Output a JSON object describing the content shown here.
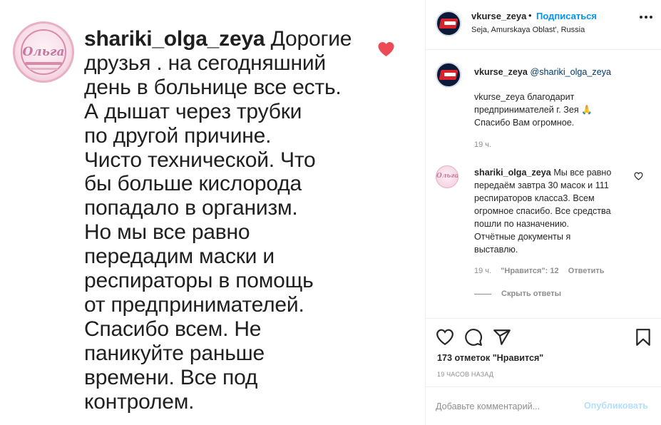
{
  "post_image": {
    "avatar_logo_text": "Ольга",
    "username": "shariki_olga_zeya",
    "text_lines": [
      "Дорогие",
      "друзья . на сегодняшний",
      "день в больнице все  есть.",
      "А дышат через трубки",
      "по другой причине.",
      "Чисто технической. Что",
      "бы больше кислорода",
      "попадало в организм.",
      "Но мы все равно",
      "передадим маски и",
      "респираторы в помощь",
      "от предпринимателей.",
      "Спасибо всем. Не",
      "паникуйте раньше",
      "времени. Все под",
      "контролем."
    ],
    "heart_color": "#ed4956"
  },
  "header": {
    "username": "vkurse_zeya",
    "dot": "•",
    "follow_label": "Подписаться",
    "location": "Seja, Amurskaya Oblast', Russia",
    "more_icon": "more-horizontal-icon"
  },
  "caption": {
    "username": "vkurse_zeya",
    "mention": "@shariki_olga_zeya",
    "lines": [
      "vkurse_zeya благодарит",
      "предпринимателей г. Зея 🙏",
      "Спасибо Вам огромное."
    ],
    "time": "19 ч."
  },
  "comment": {
    "username": "shariki_olga_zeya",
    "avatar_logo_text": "Ольга",
    "first_line": "Мы все равно",
    "lines": [
      "передаём завтра 30 масок и 111",
      "респираторов класса3. Всем",
      "огромное спасибо. Все средства",
      "пошли по назначению.",
      "Отчётные документы я",
      "выставлю."
    ],
    "time": "19 ч.",
    "likes": "\"Нравится\": 12",
    "reply_label": "Ответить",
    "hide_replies": "Скрыть ответы"
  },
  "actions": {
    "icons": [
      "heart-outline-icon",
      "comment-icon",
      "share-icon",
      "bookmark-icon"
    ],
    "likes": "173 отметок \"Нравится\"",
    "timestamp": "19 ЧАСОВ НАЗАД"
  },
  "add_comment": {
    "placeholder": "Добавьте комментарий...",
    "publish_label": "Опубликовать"
  },
  "colors": {
    "accent": "#0095f6",
    "publish_disabled": "#b2dffc",
    "secondary_text": "#8e8e8e",
    "mention_link": "#00376b"
  }
}
